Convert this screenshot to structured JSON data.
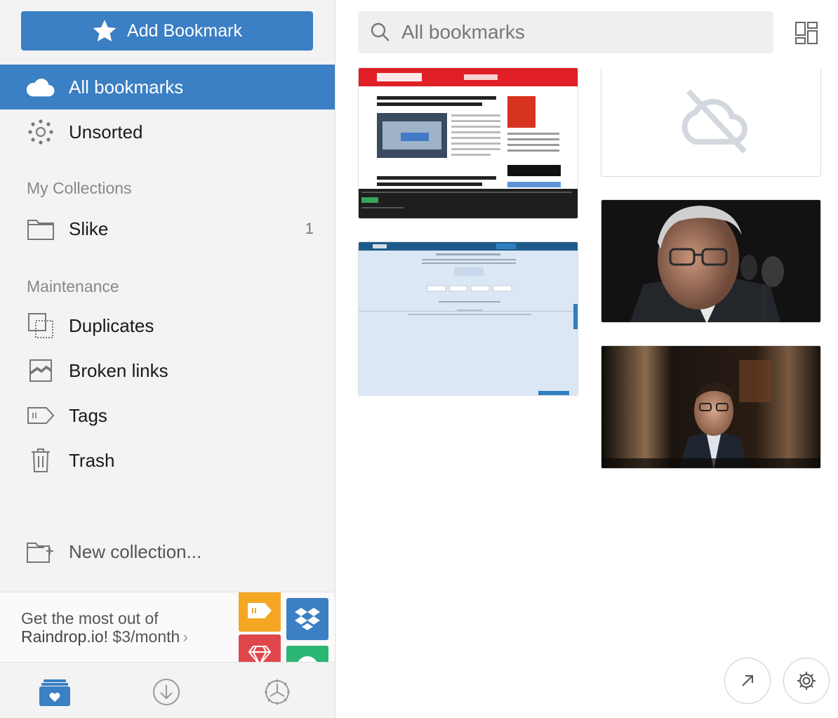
{
  "sidebar": {
    "add_bookmark": "Add Bookmark",
    "items": {
      "all": "All bookmarks",
      "unsorted": "Unsorted"
    },
    "my_collections_title": "My Collections",
    "collections": [
      {
        "label": "Slike",
        "count": "1"
      }
    ],
    "maintenance_title": "Maintenance",
    "maintenance": {
      "duplicates": "Duplicates",
      "broken": "Broken links",
      "tags": "Tags",
      "trash": "Trash"
    },
    "new_collection": "New collection...",
    "promo": {
      "line1": "Get the most out of",
      "line2": "Raindrop.io!",
      "price": "$3/month"
    }
  },
  "search": {
    "placeholder": "All bookmarks"
  },
  "colors": {
    "accent": "#3b7fc4",
    "promo_yellow": "#f5a623",
    "promo_red": "#e0474c",
    "promo_green": "#2bb673"
  },
  "icons": {
    "add": "star-icon",
    "all": "cloud-icon",
    "unsorted": "sparkle-icon",
    "folder": "folder-icon",
    "duplicates": "duplicates-icon",
    "broken": "broken-image-icon",
    "tags": "tag-icon",
    "trash": "trash-icon",
    "new_collection": "folder-plus-icon",
    "view": "grid-layout-icon",
    "open": "arrow-up-right-icon",
    "settings": "gear-icon"
  }
}
